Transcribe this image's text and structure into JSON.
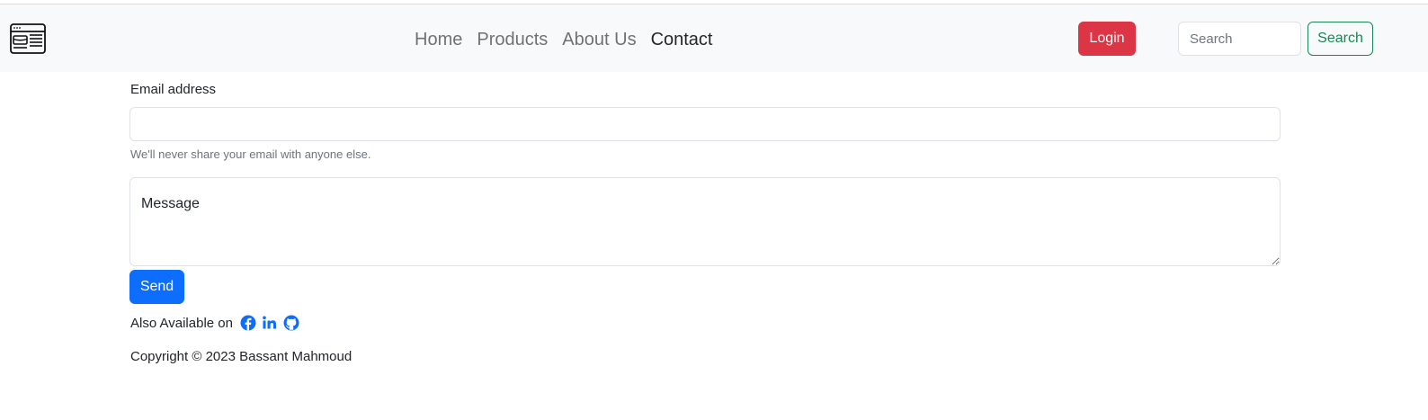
{
  "navbar": {
    "brand_icon": "browser-window-logo-icon",
    "links": [
      {
        "label": "Home",
        "active": false
      },
      {
        "label": "Products",
        "active": false
      },
      {
        "label": "About Us",
        "active": false
      },
      {
        "label": "Contact",
        "active": true
      }
    ],
    "login_label": "Login",
    "search_placeholder": "Search",
    "search_label": "Search"
  },
  "form": {
    "email_label": "Email address",
    "email_value": "",
    "email_help": "We'll never share your email with anyone else.",
    "message_placeholder": "Message",
    "send_label": "Send"
  },
  "footer": {
    "also_available": "Also Available on",
    "social_icons": [
      "facebook-icon",
      "linkedin-icon",
      "github-icon"
    ],
    "copyright": "Copyright © 2023 Bassant Mahmoud"
  },
  "colors": {
    "navbar_bg": "#f8f9fa",
    "login": "#dc3545",
    "search": "#198754",
    "send": "#0d6efd",
    "social": "#0d6efd"
  }
}
